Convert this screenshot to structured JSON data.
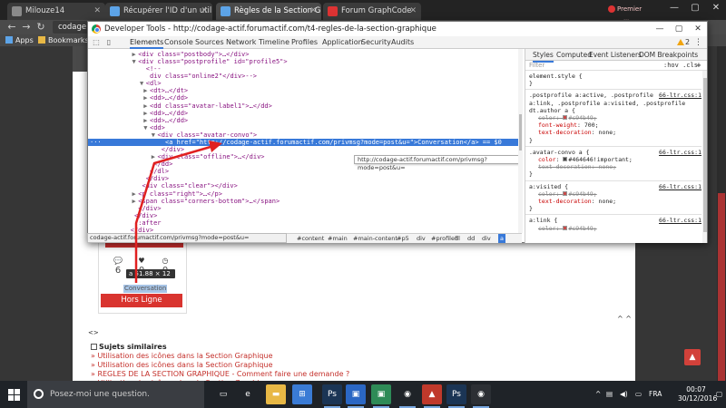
{
  "tabs": [
    {
      "label": "Milouze14",
      "color": "#8a8a8a",
      "active": false
    },
    {
      "label": "Récupérer l'ID d'un utilis",
      "color": "#5da4e8",
      "active": false
    },
    {
      "label": "Règles de la Section Grap",
      "color": "#5da4e8",
      "active": true
    },
    {
      "label": "Forum GraphCode",
      "color": "#d33",
      "active": false
    }
  ],
  "user_chip": "Premier utili...",
  "address": "codage-actif.forumactif.com/t4-regles-de-la-section-graphique",
  "address_visible": "codage",
  "bookmarks": [
    {
      "label": "Apps"
    },
    {
      "label": "Bookmarks"
    }
  ],
  "devtools": {
    "title": "Developer Tools - http://codage-actif.forumactif.com/t4-regles-de-la-section-graphique",
    "tabs": [
      "Elements",
      "Console",
      "Sources",
      "Network",
      "Timeline",
      "Profiles",
      "Application",
      "Security",
      "Audits"
    ],
    "active_tab": "Elements",
    "warning_count": "2",
    "dom_lines": [
      {
        "indent": 13,
        "tw": "▶",
        "html": "<div class=\"postbody\">…</div>"
      },
      {
        "indent": 13,
        "tw": "▼",
        "html": "<div class=\"postprofile\" id=\"profile5\">"
      },
      {
        "indent": 15,
        "tw": "",
        "html": "<!--"
      },
      {
        "indent": 16,
        "tw": "",
        "html": "div class=\"online2\"</div>-->"
      },
      {
        "indent": 15,
        "tw": "▼",
        "html": "<dl>"
      },
      {
        "indent": 16,
        "tw": "▶",
        "html": "<dt>…</dt>"
      },
      {
        "indent": 16,
        "tw": "▶",
        "html": "<dd>…</dd>"
      },
      {
        "indent": 16,
        "tw": "▶",
        "html": "<dd class=\"avatar-label1\">…</dd>"
      },
      {
        "indent": 16,
        "tw": "▶",
        "html": "<dd>…</dd>"
      },
      {
        "indent": 16,
        "tw": "▶",
        "html": "<dd>…</dd>"
      },
      {
        "indent": 16,
        "tw": "▼",
        "html": "<dd>"
      },
      {
        "indent": 18,
        "tw": "▼",
        "html": "<div class=\"avatar-convo\">"
      },
      {
        "indent": 20,
        "tw": "",
        "html": "<a href=\"http://codage-actif.forumactif.com/privmsg?mode=post&u=\">Conversation</a> == $0",
        "selected": true
      },
      {
        "indent": 19,
        "tw": "",
        "html": "</div>"
      },
      {
        "indent": 18,
        "tw": "▶",
        "html": "<div class=\"offline\">…</div>"
      },
      {
        "indent": 17,
        "tw": "",
        "html": "</dd>"
      },
      {
        "indent": 16,
        "tw": "",
        "html": "</dl>"
      },
      {
        "indent": 15,
        "tw": "",
        "html": "</div>"
      },
      {
        "indent": 14,
        "tw": "",
        "html": "<div class=\"clear\"></div>"
      },
      {
        "indent": 13,
        "tw": "▶",
        "html": "<p class=\"right\">…</p>"
      },
      {
        "indent": 13,
        "tw": "▶",
        "html": "<span class=\"corners-bottom\">…</span>"
      },
      {
        "indent": 13,
        "tw": "",
        "html": "</div>"
      },
      {
        "indent": 12,
        "tw": "",
        "html": "</div>"
      },
      {
        "indent": 12,
        "tw": "",
        "html": "::after"
      },
      {
        "indent": 11,
        "tw": "",
        "html": "</div>"
      }
    ],
    "link_tooltip": "http://codage-actif.forumactif.com/privmsg?mode=post&u=",
    "status_url": "codage-actif.forumactif.com/privmsg?mode=post&u=",
    "breadcrumbs": [
      "#content",
      "#main",
      "#main-content",
      "#p5",
      "div",
      "#profile5",
      "dl",
      "dd",
      "div",
      "a"
    ],
    "styles": {
      "tabs": [
        "Styles",
        "Computed",
        "Event Listeners",
        "DOM Breakpoints"
      ],
      "filter_placeholder": "Filter",
      "hov": ":hov  .cls",
      "plus": "+",
      "lines": [
        {
          "type": "sel",
          "text": "element.style {"
        },
        {
          "type": "close",
          "text": "}"
        },
        {
          "type": "sep"
        },
        {
          "type": "sel",
          "text": ".postprofile a:active, .postprofile",
          "src": "66-ltr.css:1"
        },
        {
          "type": "sel",
          "text": "a:link, .postprofile a:visited, .postprofile"
        },
        {
          "type": "sel",
          "text": "dt.author a {"
        },
        {
          "type": "prop",
          "prop": "color",
          "value": "#c94b49;",
          "swatch": "#c94b49",
          "strike": true
        },
        {
          "type": "prop",
          "prop": "font-weight",
          "value": "700;"
        },
        {
          "type": "prop",
          "prop": "text-decoration",
          "value": "none;"
        },
        {
          "type": "close",
          "text": "}"
        },
        {
          "type": "sep"
        },
        {
          "type": "sel",
          "text": ".avatar-convo a {",
          "src": "66-ltr.css:1"
        },
        {
          "type": "prop",
          "prop": "color",
          "value": "#464646!important;",
          "swatch": "#464646"
        },
        {
          "type": "prop",
          "prop": "text-decoration",
          "value": "none;",
          "strike": true
        },
        {
          "type": "close",
          "text": "}"
        },
        {
          "type": "sep"
        },
        {
          "type": "sel",
          "text": "a:visited {",
          "src": "66-ltr.css:1"
        },
        {
          "type": "prop",
          "prop": "color",
          "value": "#c94b49;",
          "swatch": "#c94b49",
          "strike": true
        },
        {
          "type": "prop",
          "prop": "text-decoration",
          "value": "none;"
        },
        {
          "type": "close",
          "text": "}"
        },
        {
          "type": "sep"
        },
        {
          "type": "sel",
          "text": "a:link {",
          "src": "66-ltr.css:1"
        },
        {
          "type": "prop",
          "prop": "color",
          "value": "#c94b49;",
          "swatch": "#c94b49",
          "strike": true
        }
      ]
    }
  },
  "page": {
    "stats": [
      {
        "icon": "messages-icon",
        "glyph": "💬",
        "value": "6"
      },
      {
        "icon": "heart-icon",
        "glyph": "♥",
        "value": "0"
      },
      {
        "icon": "clock-icon",
        "glyph": "◷",
        "value": "0"
      }
    ],
    "element_tooltip": "a  51.88 × 12",
    "conversation": "Conversation",
    "status_button": "Hors Ligne",
    "bb_toggle": "<>",
    "page_arrows": "^ ^",
    "similar_title": "Sujets similaires",
    "similar_items": [
      "» Utilisation des icônes dans la Section Graphique",
      "» Utilisation des icônes dans la Section Graphique",
      "» REGLES DE LA SECTION GRAPHIQUE - Comment faire une demande ?",
      "» Utilisation des icônes dans la Section Graphique"
    ]
  },
  "taskbar": {
    "search_placeholder": "Posez-moi une question.",
    "apps": [
      {
        "name": "task-view-icon",
        "glyph": "▭",
        "color": "#1f2328"
      },
      {
        "name": "edge-icon",
        "glyph": "e",
        "color": "#1f2328"
      },
      {
        "name": "explorer-icon",
        "glyph": "▬",
        "color": "#e8b845"
      },
      {
        "name": "store-icon",
        "glyph": "⊞",
        "color": "#3a7bd5"
      },
      {
        "name": "photoshop-icon",
        "glyph": "Ps",
        "color": "#1b3555"
      },
      {
        "name": "app-blue-icon",
        "glyph": "▣",
        "color": "#2b67c4"
      },
      {
        "name": "app-green-icon",
        "glyph": "▣",
        "color": "#2e8b57"
      },
      {
        "name": "chrome-icon",
        "glyph": "◉",
        "color": "#1f2328"
      },
      {
        "name": "app-red-icon",
        "glyph": "▲",
        "color": "#c0392b"
      },
      {
        "name": "photoshop2-icon",
        "glyph": "Ps",
        "color": "#1b3555"
      },
      {
        "name": "chrome2-icon",
        "glyph": "◉",
        "color": "#2c2f34"
      }
    ],
    "tray_lang": "FRA",
    "time": "00:07",
    "date": "30/12/2016"
  }
}
